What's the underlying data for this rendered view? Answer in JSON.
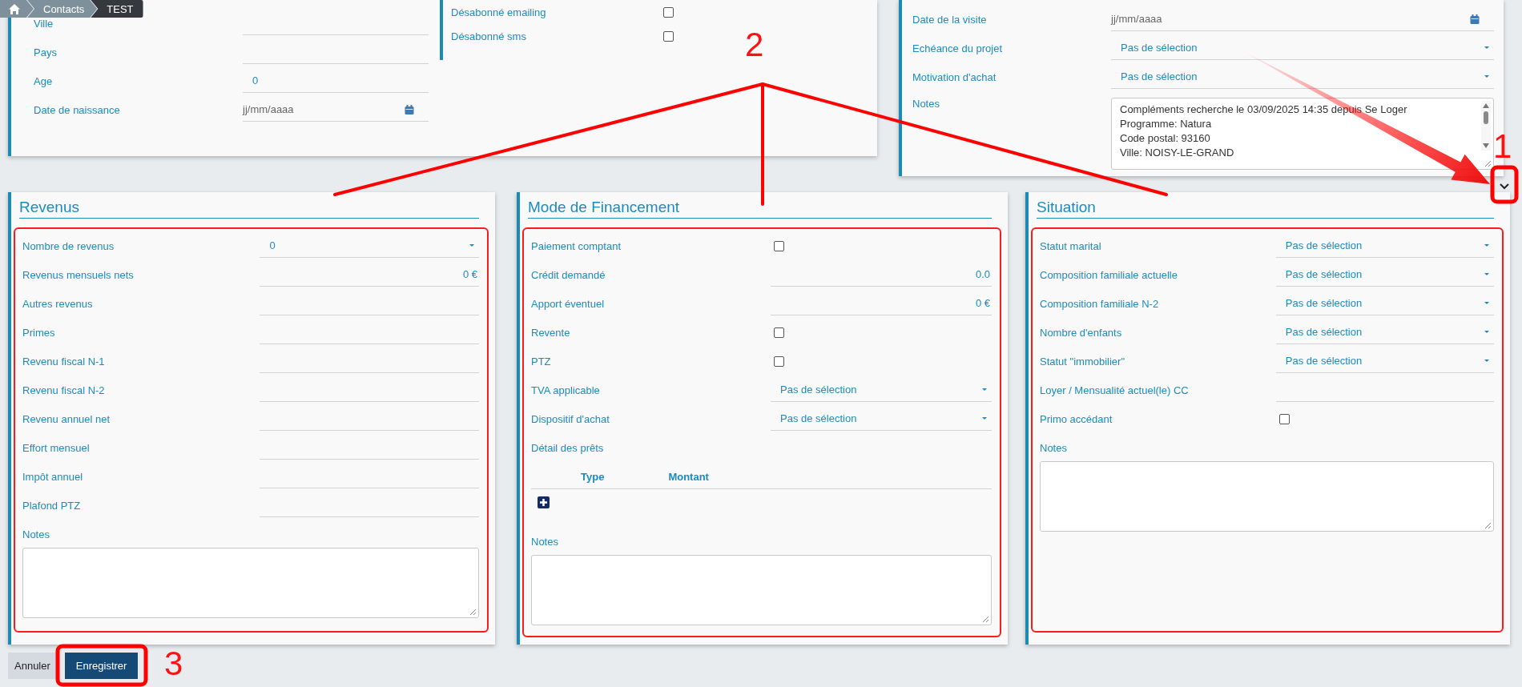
{
  "breadcrumb": [
    {
      "kind": "home",
      "current": false
    },
    {
      "kind": "link",
      "label": "Contacts",
      "current": false
    },
    {
      "kind": "link",
      "label": "TEST",
      "current": true
    }
  ],
  "contact_card": {
    "fields": [
      {
        "label": "Ville",
        "kind": "text"
      },
      {
        "label": "Pays",
        "kind": "text"
      },
      {
        "label": "Age",
        "kind": "text",
        "value": "0"
      },
      {
        "label": "Date de naissance",
        "kind": "date",
        "placeholder": "jj/mm/aaaa"
      }
    ],
    "options": [
      {
        "label": "Désabonné emailing",
        "kind": "checkbox",
        "checked": false
      },
      {
        "label": "Désabonné sms",
        "kind": "checkbox",
        "checked": false
      }
    ]
  },
  "project_card": {
    "fields": [
      {
        "label": "Date de la visite",
        "kind": "date",
        "placeholder": "jj/mm/aaaa"
      },
      {
        "label": "Echéance du projet",
        "kind": "select",
        "value": "Pas de sélection"
      },
      {
        "label": "Motivation d'achat",
        "kind": "select",
        "value": "Pas de sélection"
      },
      {
        "label": "Notes",
        "kind": "notes",
        "value": "Compléments recherche le 03/09/2025 14:35 depuis Se Loger\nProgramme: Natura\nCode postal: 93160\nVille: NOISY-LE-GRAND"
      }
    ]
  },
  "expand_button": {
    "highlighted": true
  },
  "panels": [
    {
      "title": "Revenus",
      "highlighted": true,
      "fields": [
        {
          "label": "Nombre de revenus",
          "kind": "select",
          "value": "0"
        },
        {
          "label": "Revenus mensuels nets",
          "kind": "amount",
          "value": "0 €"
        },
        {
          "label": "Autres revenus",
          "kind": "amount"
        },
        {
          "label": "Primes",
          "kind": "amount"
        },
        {
          "label": "Revenu fiscal N-1",
          "kind": "amount"
        },
        {
          "label": "Revenu fiscal N-2",
          "kind": "amount"
        },
        {
          "label": "Revenu annuel net",
          "kind": "amount"
        },
        {
          "label": "Effort mensuel",
          "kind": "amount"
        },
        {
          "label": "Impôt annuel",
          "kind": "amount"
        },
        {
          "label": "Plafond PTZ",
          "kind": "amount"
        },
        {
          "label": "Notes",
          "kind": "textarea"
        }
      ]
    },
    {
      "title": "Mode de Financement",
      "highlighted": true,
      "fields": [
        {
          "label": "Paiement comptant",
          "kind": "checkbox",
          "checked": false
        },
        {
          "label": "Crédit demandé",
          "kind": "amount",
          "value": "0.0"
        },
        {
          "label": "Apport éventuel",
          "kind": "amount",
          "value": "0 €"
        },
        {
          "label": "Revente",
          "kind": "checkbox",
          "checked": false
        },
        {
          "label": "PTZ",
          "kind": "checkbox",
          "checked": false
        },
        {
          "label": "TVA applicable",
          "kind": "select",
          "value": "Pas de sélection"
        },
        {
          "label": "Dispositif d'achat",
          "kind": "select",
          "value": "Pas de sélection"
        },
        {
          "label": "Détail des prêts",
          "kind": "table",
          "columns": [
            "Type",
            "Montant"
          ]
        },
        {
          "label": "Notes",
          "kind": "textarea"
        }
      ]
    },
    {
      "title": "Situation",
      "highlighted": true,
      "fields": [
        {
          "label": "Statut marital",
          "kind": "select",
          "value": "Pas de sélection"
        },
        {
          "label": "Composition familiale actuelle",
          "kind": "select",
          "value": "Pas de sélection"
        },
        {
          "label": "Composition familiale N-2",
          "kind": "select",
          "value": "Pas de sélection"
        },
        {
          "label": "Nombre d'enfants",
          "kind": "select",
          "value": "Pas de sélection"
        },
        {
          "label": "Statut \"immobilier\"",
          "kind": "select",
          "value": "Pas de sélection"
        },
        {
          "label": "Loyer / Mensualité actuel(le) CC",
          "kind": "amount"
        },
        {
          "label": "Primo accédant",
          "kind": "checkbox",
          "checked": false
        },
        {
          "label": "Notes",
          "kind": "textarea"
        }
      ]
    }
  ],
  "buttons": [
    {
      "label": "Annuler",
      "kind": "secondary",
      "highlighted": false
    },
    {
      "label": "Enregistrer",
      "kind": "primary",
      "highlighted": true
    }
  ],
  "annotations": [
    {
      "text": "2"
    },
    {
      "text": "1"
    },
    {
      "text": "3"
    }
  ]
}
